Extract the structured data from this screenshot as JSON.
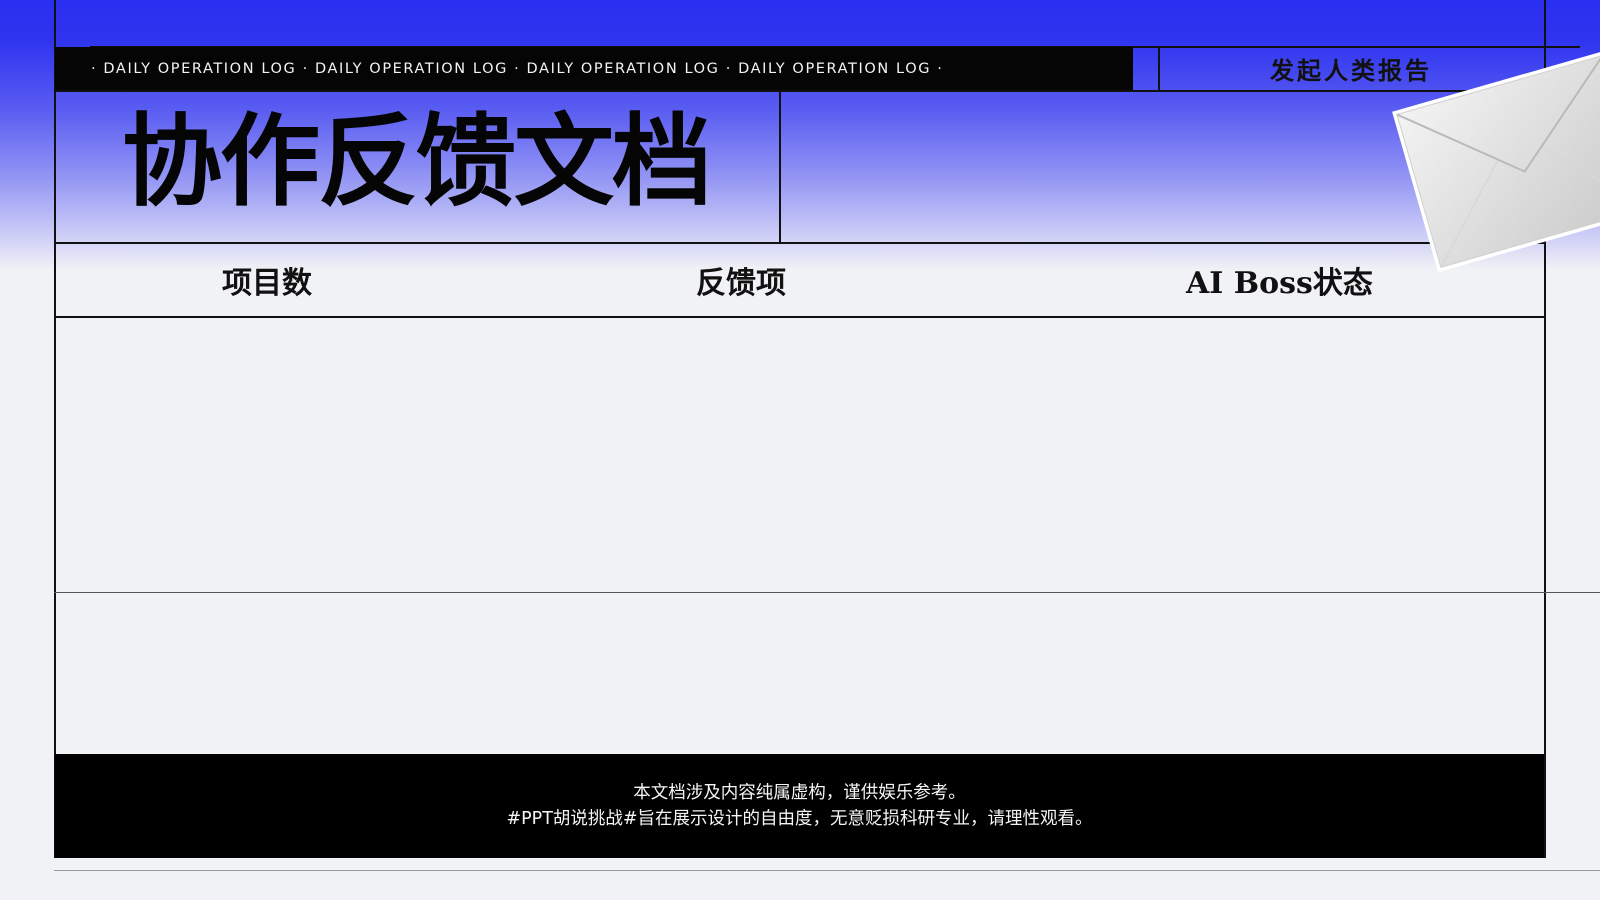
{
  "header": {
    "ticker": "· DAILY OPERATION LOG · DAILY OPERATION LOG · DAILY OPERATION LOG · DAILY OPERATION LOG ·",
    "report_label": "发起人类报告"
  },
  "title": "协作反馈文档",
  "table": {
    "columns": [
      "项目数",
      "反馈项",
      "AI Boss状态"
    ]
  },
  "footer": {
    "line1": "本文档涉及内容纯属虚构，谨供娱乐参考。",
    "line2": "#PPT胡说挑战#旨在展示设计的自由度，无意贬损科研专业，请理性观看。"
  },
  "colors": {
    "accent_blue": "#2a2ff0",
    "background": "#f1f2f5",
    "bar_black": "#050505"
  },
  "icons": {
    "envelope": "envelope-icon"
  }
}
